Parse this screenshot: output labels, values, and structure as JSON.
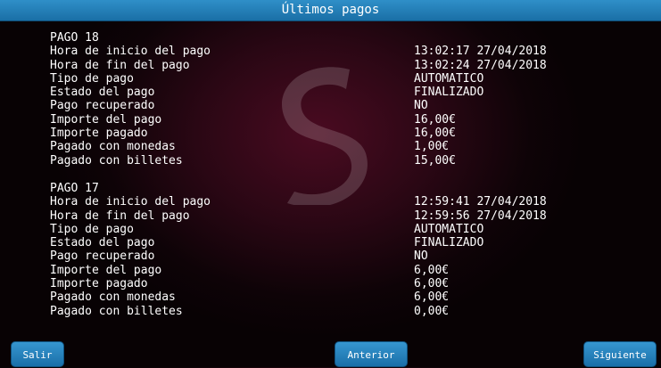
{
  "window": {
    "title": "Últimos pagos"
  },
  "payments": [
    {
      "header": "PAGO 18",
      "rows": [
        {
          "label": "Hora de inicio del pago",
          "value": "13:02:17 27/04/2018"
        },
        {
          "label": "Hora de fin del pago",
          "value": "13:02:24 27/04/2018"
        },
        {
          "label": "Tipo de pago",
          "value": "AUTOMATICO"
        },
        {
          "label": "Estado del pago",
          "value": "FINALIZADO"
        },
        {
          "label": "Pago recuperado",
          "value": "NO"
        },
        {
          "label": "Importe del pago",
          "value": "16,00€"
        },
        {
          "label": "Importe pagado",
          "value": "16,00€"
        },
        {
          "label": "Pagado con monedas",
          "value": "1,00€"
        },
        {
          "label": "Pagado con billetes",
          "value": "15,00€"
        }
      ]
    },
    {
      "header": "PAGO 17",
      "rows": [
        {
          "label": "Hora de inicio del pago",
          "value": "12:59:41 27/04/2018"
        },
        {
          "label": "Hora de fin del pago",
          "value": "12:59:56 27/04/2018"
        },
        {
          "label": "Tipo de pago",
          "value": "AUTOMATICO"
        },
        {
          "label": "Estado del pago",
          "value": "FINALIZADO"
        },
        {
          "label": "Pago recuperado",
          "value": "NO"
        },
        {
          "label": "Importe del pago",
          "value": "6,00€"
        },
        {
          "label": "Importe pagado",
          "value": "6,00€"
        },
        {
          "label": "Pagado con monedas",
          "value": "6,00€"
        },
        {
          "label": "Pagado con billetes",
          "value": "0,00€"
        }
      ]
    }
  ],
  "buttons": {
    "exit": "Salir",
    "previous": "Anterior",
    "next": "Siguiente"
  },
  "colors": {
    "titlebar": "#1f7bb6",
    "button": "#2a86c0",
    "background": "#0e0307",
    "accent_glow": "#4a0b21"
  },
  "icons": {
    "watermark": "s-logo-watermark"
  }
}
